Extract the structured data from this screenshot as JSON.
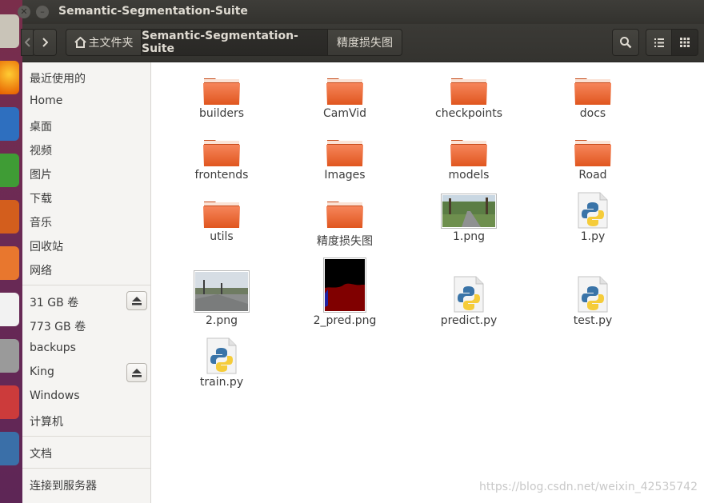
{
  "window": {
    "title": "Semantic-Segmentation-Suite",
    "close_glyph": "✕",
    "minimize_glyph": "–"
  },
  "toolbar": {
    "back_icon": "chevron-left-icon",
    "forward_icon": "chevron-right-icon",
    "breadcrumbs": [
      "主文件夹",
      "Semantic-Segmentation-Suite",
      "精度损失图"
    ],
    "search_icon": "search-icon",
    "list_view_icon": "list-view-icon",
    "grid_view_icon": "grid-view-icon"
  },
  "sidebar": {
    "places": [
      "最近使用的",
      "Home",
      "桌面",
      "视频",
      "图片",
      "下载",
      "音乐",
      "回收站",
      "网络"
    ],
    "devices": [
      "31 GB 卷",
      "773 GB 卷",
      "backups",
      "King",
      "Windows",
      "计算机"
    ],
    "bookmarks": [
      "文档"
    ],
    "other": [
      "连接到服务器"
    ]
  },
  "files": [
    {
      "name": "builders",
      "type": "folder"
    },
    {
      "name": "CamVid",
      "type": "folder"
    },
    {
      "name": "checkpoints",
      "type": "folder"
    },
    {
      "name": "docs",
      "type": "folder"
    },
    {
      "name": "frontends",
      "type": "folder"
    },
    {
      "name": "Images",
      "type": "folder"
    },
    {
      "name": "models",
      "type": "folder"
    },
    {
      "name": "Road",
      "type": "folder"
    },
    {
      "name": "utils",
      "type": "folder"
    },
    {
      "name": "精度损失图",
      "type": "folder"
    },
    {
      "name": "1.png",
      "type": "image"
    },
    {
      "name": "1.py",
      "type": "python"
    },
    {
      "name": "2.png",
      "type": "image"
    },
    {
      "name": "2_pred.png",
      "type": "image"
    },
    {
      "name": "predict.py",
      "type": "python"
    },
    {
      "name": "test.py",
      "type": "python"
    },
    {
      "name": "train.py",
      "type": "python"
    }
  ],
  "watermark": "https://blog.csdn.net/weixin_42535742",
  "colors": {
    "folder_top": "#f6855a",
    "folder_bottom": "#e0561f",
    "launcher": "#6b2a55",
    "titlebar": "#3c3b37"
  }
}
